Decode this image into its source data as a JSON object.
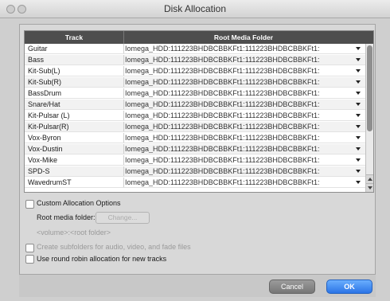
{
  "window": {
    "title": "Disk Allocation"
  },
  "table": {
    "headers": [
      "Track",
      "Root Media Folder"
    ],
    "rows": [
      {
        "track": "Guitar",
        "folder": "Iomega_HDD:111223BHDBCBBKFt1:111223BHDBCBBKFt1:"
      },
      {
        "track": "Bass",
        "folder": "Iomega_HDD:111223BHDBCBBKFt1:111223BHDBCBBKFt1:"
      },
      {
        "track": "Kit-Sub(L)",
        "folder": "Iomega_HDD:111223BHDBCBBKFt1:111223BHDBCBBKFt1:"
      },
      {
        "track": "Kit-Sub(R)",
        "folder": "Iomega_HDD:111223BHDBCBBKFt1:111223BHDBCBBKFt1:"
      },
      {
        "track": "BassDrum",
        "folder": "Iomega_HDD:111223BHDBCBBKFt1:111223BHDBCBBKFt1:"
      },
      {
        "track": "Snare/Hat",
        "folder": "Iomega_HDD:111223BHDBCBBKFt1:111223BHDBCBBKFt1:"
      },
      {
        "track": "Kit-Pulsar (L)",
        "folder": "Iomega_HDD:111223BHDBCBBKFt1:111223BHDBCBBKFt1:"
      },
      {
        "track": "Kit-Pulsar(R)",
        "folder": "Iomega_HDD:111223BHDBCBBKFt1:111223BHDBCBBKFt1:"
      },
      {
        "track": "Vox-Byron",
        "folder": "Iomega_HDD:111223BHDBCBBKFt1:111223BHDBCBBKFt1:"
      },
      {
        "track": "Vox-Dustin",
        "folder": "Iomega_HDD:111223BHDBCBBKFt1:111223BHDBCBBKFt1:"
      },
      {
        "track": "Vox-Mike",
        "folder": "Iomega_HDD:111223BHDBCBBKFt1:111223BHDBCBBKFt1:"
      },
      {
        "track": "SPD-S",
        "folder": "Iomega_HDD:111223BHDBCBBKFt1:111223BHDBCBBKFt1:"
      },
      {
        "track": "WavedrumST",
        "folder": "Iomega_HDD:111223BHDBCBBKFt1:111223BHDBCBBKFt1:"
      }
    ]
  },
  "options": {
    "custom_allocation": "Custom Allocation Options",
    "root_media_label": "Root media folder:",
    "root_media_button": "Change...",
    "volume_path": "<volume>:<root folder>",
    "create_subfolders": "Create subfolders for audio, video, and fade files",
    "round_robin": "Use round robin allocation for new tracks"
  },
  "buttons": {
    "cancel": "Cancel",
    "ok": "OK"
  }
}
